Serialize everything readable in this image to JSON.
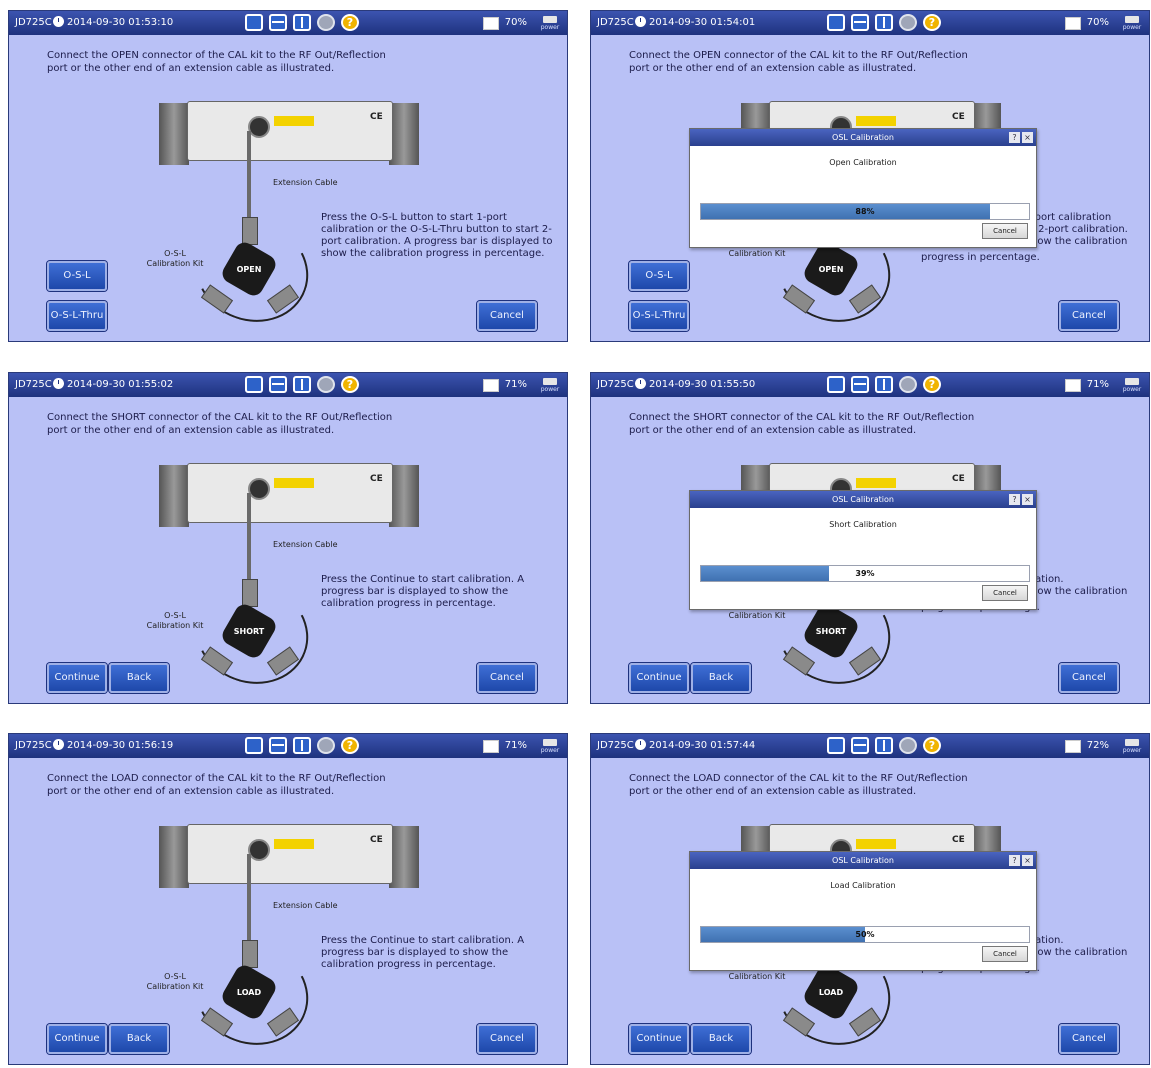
{
  "panels": [
    {
      "device": "JD725C",
      "datetime": "2014-09-30 01:53:10",
      "battery": "70%",
      "power": "power",
      "instruction": "Connect the OPEN connector of the CAL kit to the RF Out/Reflection port or the other end of an extension cable as illustrated.",
      "kit_label": "OPEN",
      "cable_label": "Extension Cable",
      "kit_caption": "O-S-L Calibration Kit",
      "description": "Press the O-S-L button to start 1-port calibration or the O-S-L-Thru button to start 2-port calibration. A progress bar is displayed to show the calibration progress in percentage.",
      "buttons": [
        "O-S-L",
        "O-S-L-Thru"
      ],
      "cancel": "Cancel"
    },
    {
      "device": "JD725C",
      "datetime": "2014-09-30 01:54:01",
      "battery": "70%",
      "power": "power",
      "instruction": "Connect the OPEN connector of the CAL kit to the RF Out/Reflection port or the other end of an extension cable as illustrated.",
      "kit_label": "OPEN",
      "kit_caption": "Calibration Kit",
      "description_fragments": [
        "-port calibration",
        "t 2-port calibration.",
        "how the calibration",
        "progress in percentage."
      ],
      "buttons": [
        "O-S-L",
        "O-S-L-Thru"
      ],
      "cancel": "Cancel",
      "dialog": {
        "title": "OSL Calibration",
        "subtitle": "Open Calibration",
        "progress": 0.88,
        "progress_label": "88%",
        "cancel": "Cancel",
        "help": "?",
        "close": "×"
      }
    },
    {
      "device": "JD725C",
      "datetime": "2014-09-30 01:55:02",
      "battery": "71%",
      "power": "power",
      "instruction": "Connect the SHORT connector of the CAL kit to the RF Out/Reflection port or the other end of an extension cable as illustrated.",
      "kit_label": "SHORT",
      "cable_label": "Extension Cable",
      "kit_caption": "O-S-L Calibration Kit",
      "description": "Press the Continue to start calibration. A progress bar is displayed to show the calibration progress in percentage.",
      "buttons": [
        "Continue",
        "Back"
      ],
      "cancel": "Cancel"
    },
    {
      "device": "JD725C",
      "datetime": "2014-09-30 01:55:50",
      "battery": "71%",
      "power": "power",
      "instruction": "Connect the SHORT connector of the CAL kit to the RF Out/Reflection port or the other end of an extension cable as illustrated.",
      "kit_label": "SHORT",
      "kit_caption": "Calibration Kit",
      "description_fragments": [
        "ration.",
        "how the calibration",
        "progress in percentage."
      ],
      "buttons": [
        "Continue",
        "Back"
      ],
      "cancel": "Cancel",
      "dialog": {
        "title": "OSL Calibration",
        "subtitle": "Short Calibration",
        "progress": 0.39,
        "progress_label": "39%",
        "cancel": "Cancel",
        "help": "?",
        "close": "×"
      }
    },
    {
      "device": "JD725C",
      "datetime": "2014-09-30 01:56:19",
      "battery": "71%",
      "power": "power",
      "instruction": "Connect the LOAD connector of the CAL kit to the RF Out/Reflection port or the other end of an extension cable as illustrated.",
      "kit_label": "LOAD",
      "cable_label": "Extension Cable",
      "kit_caption": "O-S-L Calibration Kit",
      "description": "Press the Continue to start calibration. A progress bar is displayed to show the calibration progress in percentage.",
      "buttons": [
        "Continue",
        "Back"
      ],
      "cancel": "Cancel"
    },
    {
      "device": "JD725C",
      "datetime": "2014-09-30 01:57:44",
      "battery": "72%",
      "power": "power",
      "instruction": "Connect the LOAD connector of the CAL kit to the RF Out/Reflection port or the other end of an extension cable as illustrated.",
      "kit_label": "LOAD",
      "kit_caption": "Calibration Kit",
      "description_fragments": [
        "ration.",
        "how the calibration",
        "progress in percentage."
      ],
      "buttons": [
        "Continue",
        "Back"
      ],
      "cancel": "Cancel",
      "dialog": {
        "title": "OSL Calibration",
        "subtitle": "Load Calibration",
        "progress": 0.5,
        "progress_label": "50%",
        "cancel": "Cancel",
        "help": "?",
        "close": "×"
      }
    }
  ]
}
